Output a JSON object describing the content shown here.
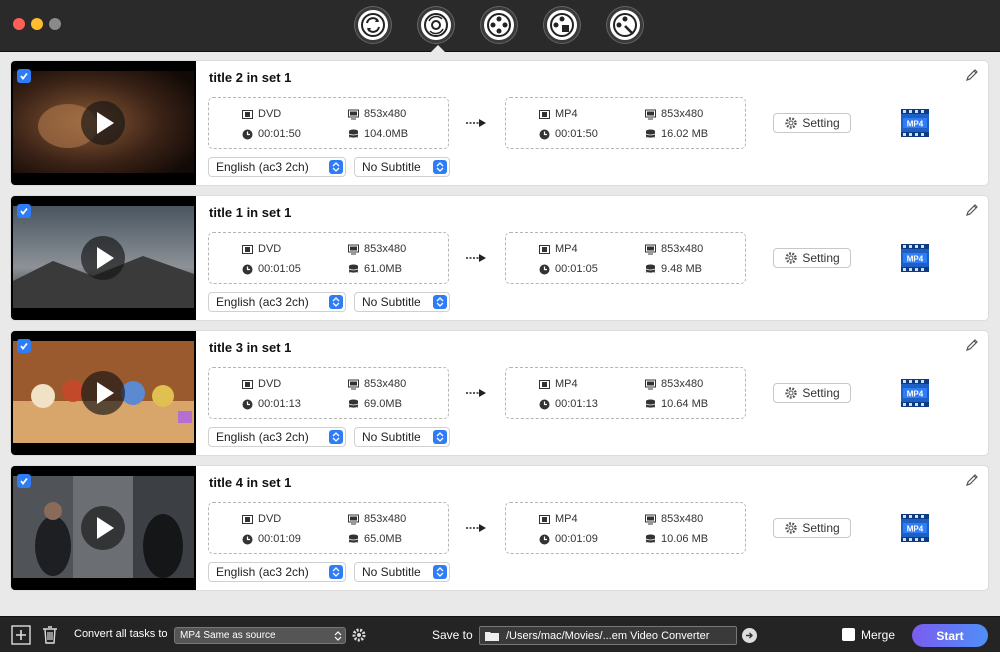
{
  "window": {
    "controls": [
      "close",
      "minimize",
      "maximize"
    ],
    "toolbar": [
      {
        "icon": "convert-icon",
        "active": false
      },
      {
        "icon": "dvd-convert-icon",
        "active": true
      },
      {
        "icon": "film-reel-icon",
        "active": false
      },
      {
        "icon": "film-edit-icon",
        "active": false
      },
      {
        "icon": "film-tools-icon",
        "active": false
      }
    ]
  },
  "labels": {
    "setting": "Setting",
    "convert_all": "Convert all tasks to",
    "save_to": "Save to",
    "merge": "Merge",
    "start": "Start"
  },
  "tasks": [
    {
      "title": "title 2 in set 1",
      "checked": true,
      "source": {
        "format": "DVD",
        "resolution": "853x480",
        "duration": "00:01:50",
        "size": "104.0MB"
      },
      "output": {
        "format": "MP4",
        "resolution": "853x480",
        "duration": "00:01:50",
        "size": "16.02 MB"
      },
      "audio": "English (ac3 2ch)",
      "subtitle": "No Subtitle",
      "output_badge": "MP4"
    },
    {
      "title": "title 1 in set 1",
      "checked": true,
      "source": {
        "format": "DVD",
        "resolution": "853x480",
        "duration": "00:01:05",
        "size": "61.0MB"
      },
      "output": {
        "format": "MP4",
        "resolution": "853x480",
        "duration": "00:01:05",
        "size": "9.48 MB"
      },
      "audio": "English (ac3 2ch)",
      "subtitle": "No Subtitle",
      "output_badge": "MP4"
    },
    {
      "title": "title 3 in set 1",
      "checked": true,
      "source": {
        "format": "DVD",
        "resolution": "853x480",
        "duration": "00:01:13",
        "size": "69.0MB"
      },
      "output": {
        "format": "MP4",
        "resolution": "853x480",
        "duration": "00:01:13",
        "size": "10.64 MB"
      },
      "audio": "English (ac3 2ch)",
      "subtitle": "No Subtitle",
      "output_badge": "MP4"
    },
    {
      "title": "title 4 in set 1",
      "checked": true,
      "source": {
        "format": "DVD",
        "resolution": "853x480",
        "duration": "00:01:09",
        "size": "65.0MB"
      },
      "output": {
        "format": "MP4",
        "resolution": "853x480",
        "duration": "00:01:09",
        "size": "10.06 MB"
      },
      "audio": "English (ac3 2ch)",
      "subtitle": "No Subtitle",
      "output_badge": "MP4"
    }
  ],
  "bottom": {
    "format_select": "MP4 Same as source",
    "save_path": "/Users/mac/Movies/...em Video Converter",
    "merge_checked": false
  },
  "colors": {
    "accent": "#2f7df6",
    "start_gradient_from": "#7b5cf0",
    "start_gradient_to": "#4f8ff7",
    "titlebar": "#2a2a2a",
    "bottom_bar": "#242424"
  }
}
